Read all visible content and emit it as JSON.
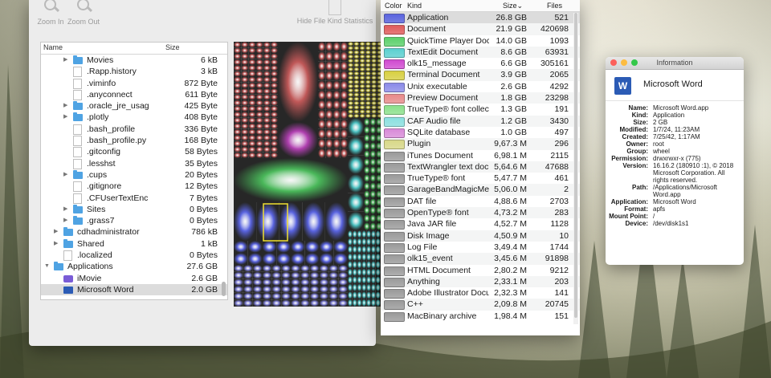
{
  "toolbar": {
    "zoom_in": "Zoom In",
    "zoom_out": "Zoom Out",
    "hide_stats": "Hide File Kind Statistics"
  },
  "tree": {
    "col_name": "Name",
    "col_size": "Size",
    "rows": [
      {
        "name": "Movies",
        "size": "6 kB",
        "level": 2,
        "icon": "folder",
        "expandable": true,
        "expanded": false
      },
      {
        "name": ".Rapp.history",
        "size": "3 kB",
        "level": 2,
        "icon": "file",
        "expandable": false
      },
      {
        "name": ".viminfo",
        "size": "872 Byte",
        "level": 2,
        "icon": "file",
        "expandable": false
      },
      {
        "name": ".anyconnect",
        "size": "611 Byte",
        "level": 2,
        "icon": "file",
        "expandable": false
      },
      {
        "name": ".oracle_jre_usag",
        "size": "425 Byte",
        "level": 2,
        "icon": "folder",
        "expandable": true,
        "expanded": false
      },
      {
        "name": ".plotly",
        "size": "408 Byte",
        "level": 2,
        "icon": "folder",
        "expandable": true,
        "expanded": false
      },
      {
        "name": ".bash_profile",
        "size": "336 Byte",
        "level": 2,
        "icon": "file",
        "expandable": false
      },
      {
        "name": ".bash_profile.py",
        "size": "168 Byte",
        "level": 2,
        "icon": "file",
        "expandable": false
      },
      {
        "name": ".gitconfig",
        "size": "58 Bytes",
        "level": 2,
        "icon": "file",
        "expandable": false
      },
      {
        "name": ".lesshst",
        "size": "35 Bytes",
        "level": 2,
        "icon": "file",
        "expandable": false
      },
      {
        "name": ".cups",
        "size": "20 Bytes",
        "level": 2,
        "icon": "folder",
        "expandable": true,
        "expanded": false
      },
      {
        "name": ".gitignore",
        "size": "12 Bytes",
        "level": 2,
        "icon": "file",
        "expandable": false
      },
      {
        "name": ".CFUserTextEnc",
        "size": "7 Bytes",
        "level": 2,
        "icon": "file",
        "expandable": false
      },
      {
        "name": "Sites",
        "size": "0 Bytes",
        "level": 2,
        "icon": "folder",
        "expandable": true,
        "expanded": false
      },
      {
        "name": ".grass7",
        "size": "0 Bytes",
        "level": 2,
        "icon": "folder",
        "expandable": true,
        "expanded": false
      },
      {
        "name": "cdhadministrator",
        "size": "786 kB",
        "level": 1,
        "icon": "folder",
        "expandable": true,
        "expanded": false
      },
      {
        "name": "Shared",
        "size": "1 kB",
        "level": 1,
        "icon": "folder",
        "expandable": true,
        "expanded": false
      },
      {
        "name": ".localized",
        "size": "0 Bytes",
        "level": 1,
        "icon": "file",
        "expandable": false
      },
      {
        "name": "Applications",
        "size": "27.6 GB",
        "level": 0,
        "icon": "folder",
        "expandable": true,
        "expanded": true
      },
      {
        "name": "iMovie",
        "size": "2.6 GB",
        "level": 1,
        "icon": "app",
        "expandable": false
      },
      {
        "name": "Microsoft Word",
        "size": "2.0 GB",
        "level": 1,
        "icon": "word",
        "expandable": false,
        "selected": true
      }
    ]
  },
  "kinds": {
    "col_color": "Color",
    "col_kind": "Kind",
    "col_size": "Size⌄",
    "col_files": "Files",
    "rows": [
      {
        "kind": "Application",
        "size": "26.8 GB",
        "files": "521",
        "color": "#5a64e0"
      },
      {
        "kind": "Document",
        "size": "21.9 GB",
        "files": "420698",
        "color": "#e05a5a"
      },
      {
        "kind": "QuickTime Player Doc",
        "size": "14.0 GB",
        "files": "1093",
        "color": "#5ad06a"
      },
      {
        "kind": "TextEdit Document",
        "size": "8.6 GB",
        "files": "63931",
        "color": "#5ad0d0"
      },
      {
        "kind": "olk15_message",
        "size": "6.6 GB",
        "files": "305161",
        "color": "#d04ad0"
      },
      {
        "kind": "Terminal Document",
        "size": "3.9 GB",
        "files": "2065",
        "color": "#d8d040"
      },
      {
        "kind": "Unix executable",
        "size": "2.6 GB",
        "files": "4292",
        "color": "#8a8ae8"
      },
      {
        "kind": "Preview Document",
        "size": "1.8 GB",
        "files": "23298",
        "color": "#e88a8a"
      },
      {
        "kind": "TrueType® font collect",
        "size": "1.3 GB",
        "files": "191",
        "color": "#8ae08a"
      },
      {
        "kind": "CAF Audio file",
        "size": "1.2 GB",
        "files": "3430",
        "color": "#8ae0e0"
      },
      {
        "kind": "SQLite database",
        "size": "1.0 GB",
        "files": "497",
        "color": "#d88ad8"
      },
      {
        "kind": "Plugin",
        "size": "9,67.3 M",
        "files": "296",
        "color": "#d8d888"
      },
      {
        "kind": "iTunes Document",
        "size": "6,98.1 M",
        "files": "2115",
        "color": "#9a9a9a"
      },
      {
        "kind": "TextWrangler text doc",
        "size": "5,64.6 M",
        "files": "47688",
        "color": "#9a9a9a"
      },
      {
        "kind": "TrueType® font",
        "size": "5,47.7 M",
        "files": "461",
        "color": "#9a9a9a"
      },
      {
        "kind": "GarageBandMagicMer",
        "size": "5,06.0 M",
        "files": "2",
        "color": "#9a9a9a"
      },
      {
        "kind": "DAT file",
        "size": "4,88.6 M",
        "files": "2703",
        "color": "#9a9a9a"
      },
      {
        "kind": "OpenType® font",
        "size": "4,73.2 M",
        "files": "283",
        "color": "#9a9a9a"
      },
      {
        "kind": "Java JAR file",
        "size": "4,52.7 M",
        "files": "1128",
        "color": "#9a9a9a"
      },
      {
        "kind": "Disk Image",
        "size": "4,50.9 M",
        "files": "10",
        "color": "#9a9a9a"
      },
      {
        "kind": "Log File",
        "size": "3,49.4 M",
        "files": "1744",
        "color": "#9a9a9a"
      },
      {
        "kind": "olk15_event",
        "size": "3,45.6 M",
        "files": "91898",
        "color": "#9a9a9a"
      },
      {
        "kind": "HTML Document",
        "size": "2,80.2 M",
        "files": "9212",
        "color": "#9a9a9a"
      },
      {
        "kind": "Anything",
        "size": "2,33.1 M",
        "files": "203",
        "color": "#9a9a9a"
      },
      {
        "kind": "Adobe Illustrator Docu",
        "size": "2,32.3 M",
        "files": "141",
        "color": "#9a9a9a"
      },
      {
        "kind": "C++",
        "size": "2,09.8 M",
        "files": "20745",
        "color": "#9a9a9a"
      },
      {
        "kind": "MacBinary archive",
        "size": "1,98.4 M",
        "files": "151",
        "color": "#9a9a9a"
      }
    ]
  },
  "info": {
    "title": "Information",
    "app_name": "Microsoft Word",
    "fields": [
      {
        "label": "Name:",
        "value": "Microsoft Word.app"
      },
      {
        "label": "Kind:",
        "value": "Application"
      },
      {
        "label": "Size:",
        "value": "2 GB"
      },
      {
        "label": "Modified:",
        "value": "1/7/24, 11:23AM"
      },
      {
        "label": "Created:",
        "value": "7/25/42, 1:17AM"
      },
      {
        "label": "Owner:",
        "value": "root"
      },
      {
        "label": "Group:",
        "value": "wheel"
      },
      {
        "label": "Permission:",
        "value": "drwxrwxr-x (775)"
      },
      {
        "label": "Version:",
        "value": "16.16.2 (180910 :1), © 2018 Microsoft Corporation. All rights reserved."
      },
      {
        "label": "Path:",
        "value": "/Applications/Microsoft Word.app"
      },
      {
        "label": "Application:",
        "value": "Microsoft Word"
      },
      {
        "label": "Format:",
        "value": "apfs"
      },
      {
        "label": "Mount Point:",
        "value": "/"
      },
      {
        "label": "Device:",
        "value": "/dev/disk1s1"
      }
    ]
  },
  "colors": {
    "traffic_close": "#fc605b",
    "traffic_min": "#fdbc40",
    "traffic_max": "#34c84a"
  }
}
